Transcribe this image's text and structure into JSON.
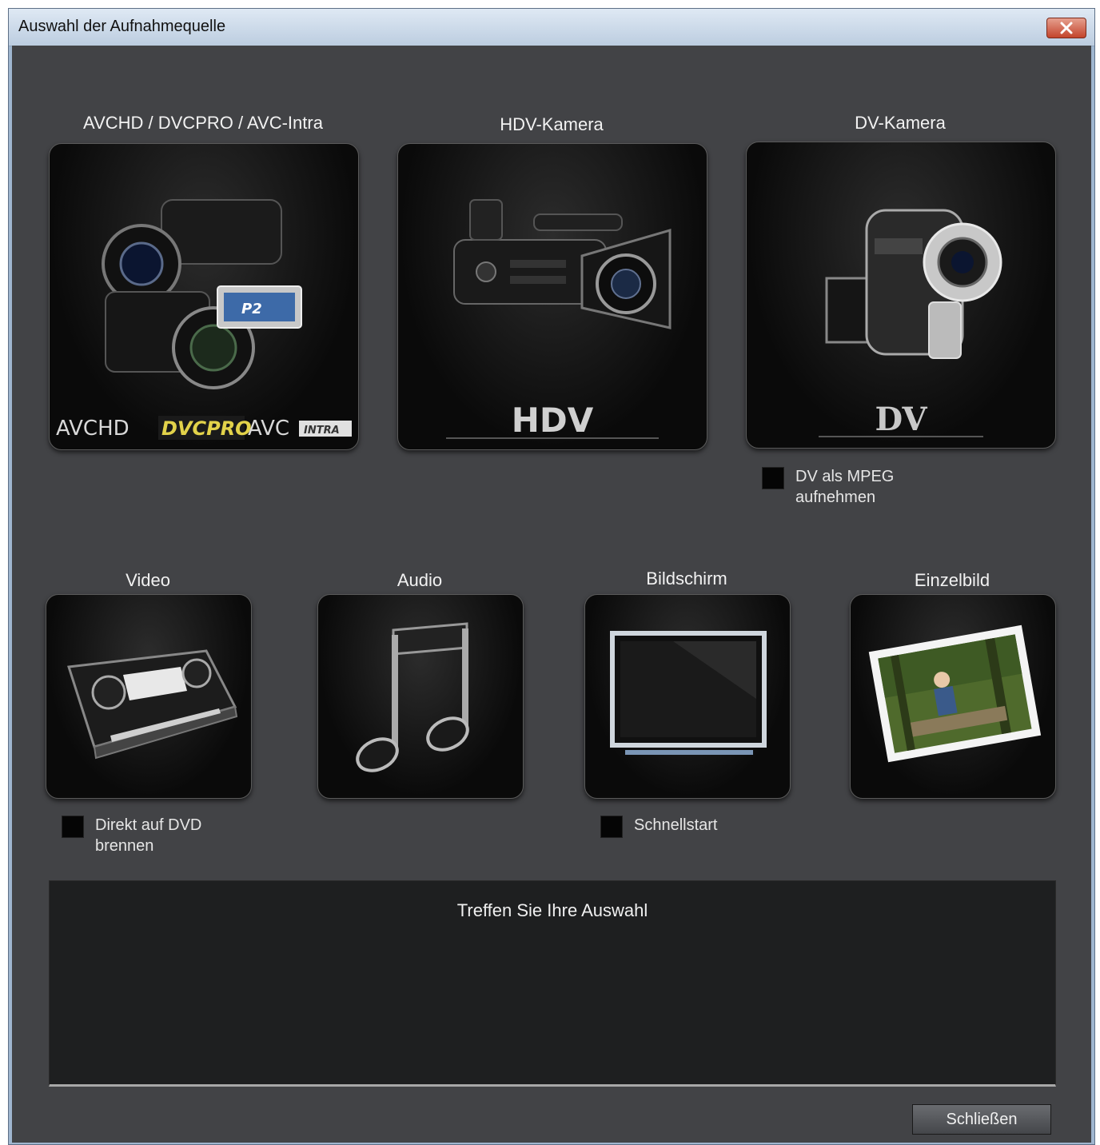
{
  "window": {
    "title": "Auswahl der Aufnahmequelle",
    "close_icon": "close-icon"
  },
  "sources_top": [
    {
      "label": "AVCHD / DVCPRO / AVC-Intra",
      "icon": "camcorder-group-icon",
      "logo_text": "AVCHD DVCPRO AVC INTRA"
    },
    {
      "label": "HDV-Kamera",
      "icon": "hdv-camera-icon",
      "logo_text": "HDV"
    },
    {
      "label": "DV-Kamera",
      "icon": "dv-camera-icon",
      "logo_text": "DV"
    }
  ],
  "sources_bottom": [
    {
      "label": "Video",
      "icon": "vhs-cassette-icon"
    },
    {
      "label": "Audio",
      "icon": "music-note-icon"
    },
    {
      "label": "Bildschirm",
      "icon": "monitor-icon"
    },
    {
      "label": "Einzelbild",
      "icon": "photo-icon"
    }
  ],
  "options": {
    "dv_mpeg": {
      "label": "DV als MPEG aufnehmen",
      "checked": false
    },
    "direct_dvd": {
      "label": "Direkt auf DVD brennen",
      "checked": false
    },
    "quickstart": {
      "label": "Schnellstart",
      "checked": false
    }
  },
  "info": {
    "text": "Treffen Sie Ihre Auswahl"
  },
  "buttons": {
    "close_label": "Schließen"
  }
}
